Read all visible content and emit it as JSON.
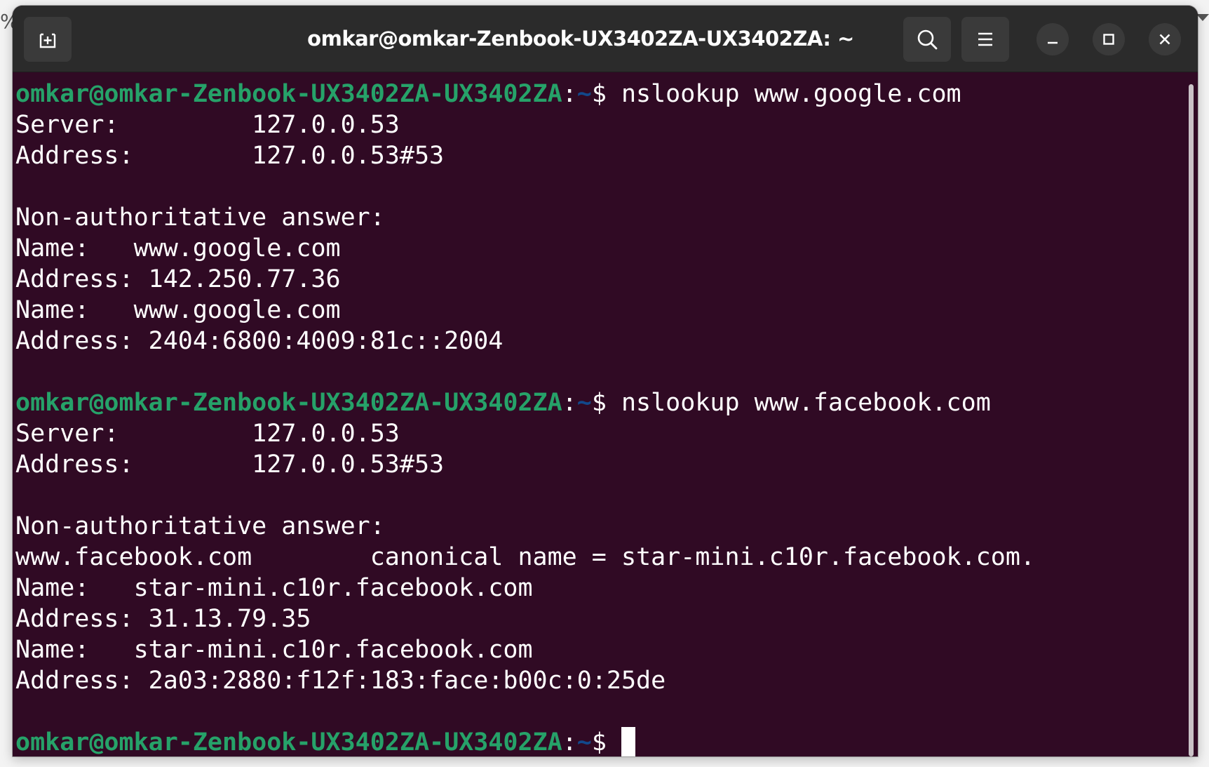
{
  "background": {
    "left_fragment": "%"
  },
  "window": {
    "title": "omkar@omkar-Zenbook-UX3402ZA-UX3402ZA: ~",
    "buttons": {
      "new_tab_icon": "new-tab-icon",
      "search_icon": "search-icon",
      "menu_icon": "hamburger-menu-icon",
      "minimize_icon": "minimize-icon",
      "maximize_icon": "maximize-icon",
      "close_icon": "close-icon"
    }
  },
  "terminal": {
    "colors": {
      "background": "#300a24",
      "prompt_user": "#26a269",
      "prompt_path": "#12488b",
      "text": "#ffffff"
    },
    "prompt": {
      "user_host": "omkar@omkar-Zenbook-UX3402ZA-UX3402ZA",
      "colon": ":",
      "path": "~",
      "dollar": "$ "
    },
    "lines": [
      {
        "type": "prompt",
        "command": "nslookup www.google.com"
      },
      {
        "type": "output",
        "text": "Server:\t\t127.0.0.53"
      },
      {
        "type": "output",
        "text": "Address:\t127.0.0.53#53"
      },
      {
        "type": "output",
        "text": ""
      },
      {
        "type": "output",
        "text": "Non-authoritative answer:"
      },
      {
        "type": "output",
        "text": "Name:\twww.google.com"
      },
      {
        "type": "output",
        "text": "Address: 142.250.77.36"
      },
      {
        "type": "output",
        "text": "Name:\twww.google.com"
      },
      {
        "type": "output",
        "text": "Address: 2404:6800:4009:81c::2004"
      },
      {
        "type": "output",
        "text": ""
      },
      {
        "type": "prompt",
        "command": "nslookup www.facebook.com"
      },
      {
        "type": "output",
        "text": "Server:\t\t127.0.0.53"
      },
      {
        "type": "output",
        "text": "Address:\t127.0.0.53#53"
      },
      {
        "type": "output",
        "text": ""
      },
      {
        "type": "output",
        "text": "Non-authoritative answer:"
      },
      {
        "type": "output",
        "text": "www.facebook.com\tcanonical name = star-mini.c10r.facebook.com."
      },
      {
        "type": "output",
        "text": "Name:\tstar-mini.c10r.facebook.com"
      },
      {
        "type": "output",
        "text": "Address: 31.13.79.35"
      },
      {
        "type": "output",
        "text": "Name:\tstar-mini.c10r.facebook.com"
      },
      {
        "type": "output",
        "text": "Address: 2a03:2880:f12f:183:face:b00c:0:25de"
      },
      {
        "type": "output",
        "text": ""
      },
      {
        "type": "prompt",
        "command": "",
        "cursor": true
      }
    ]
  }
}
